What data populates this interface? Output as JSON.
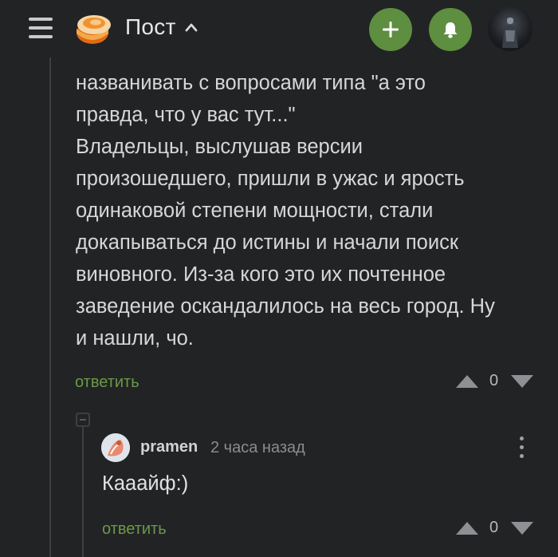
{
  "header": {
    "title": "Пост",
    "icons": {
      "menu": "menu-icon",
      "logo": "pikabu-logo-icon",
      "chevron": "chevron-up-icon",
      "add": "plus-icon",
      "notify": "bell-icon"
    },
    "accent_color": "#5e8e3f"
  },
  "comment": {
    "text": "названивать с вопросами типа \"а это\nправда, что у вас тут...\"\nВладельцы, выслушав версии\nпроизошедшего, пришли в ужас и ярость\nодинаковой степени мощности, стали\nдокапываться до истины и начали поиск\nвиновного. Из-за кого это их почтенное\nзаведение оскандалилось на весь город. Ну\nи нашли, чо.",
    "reply_label": "ответить",
    "rating": "0"
  },
  "reply": {
    "author": "pramen",
    "time": "2 часа назад",
    "text": "Кааайф:)",
    "reply_label": "ответить",
    "rating": "0"
  }
}
